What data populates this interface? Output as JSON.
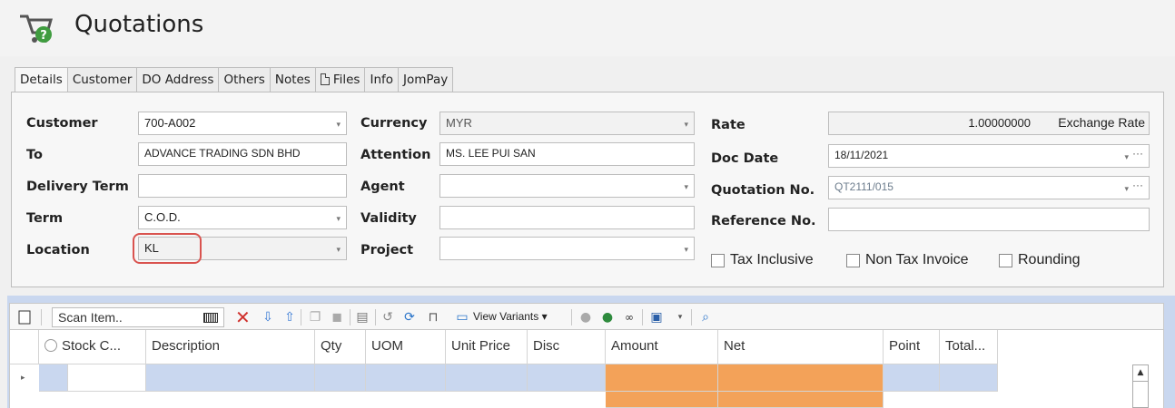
{
  "window": {
    "title": "Quotations"
  },
  "tabs": [
    {
      "label": "Details",
      "active": true
    },
    {
      "label": "Customer"
    },
    {
      "label": "DO Address"
    },
    {
      "label": "Others"
    },
    {
      "label": "Notes"
    },
    {
      "label": "Files",
      "icon": "file-icon"
    },
    {
      "label": "Info"
    },
    {
      "label": "JomPay"
    }
  ],
  "form": {
    "customer_label": "Customer",
    "customer_value": "700-A002",
    "to_label": "To",
    "to_value": "ADVANCE TRADING SDN BHD",
    "delivery_term_label": "Delivery Term",
    "delivery_term_value": "",
    "term_label": "Term",
    "term_value": "C.O.D.",
    "location_label": "Location",
    "location_value": "KL",
    "currency_label": "Currency",
    "currency_value": "MYR",
    "attention_label": "Attention",
    "attention_value": "MS. LEE PUI SAN",
    "agent_label": "Agent",
    "agent_value": "",
    "validity_label": "Validity",
    "validity_value": "",
    "project_label": "Project",
    "project_value": "",
    "rate_label": "Rate",
    "rate_value": "1.00000000",
    "exchange_rate_label": "Exchange Rate",
    "doc_date_label": "Doc Date",
    "doc_date_value": "18/11/2021",
    "quotation_no_label": "Quotation No.",
    "quotation_no_value": "QT2111/015",
    "reference_no_label": "Reference No.",
    "reference_no_value": "",
    "tax_inclusive_label": "Tax Inclusive",
    "non_tax_invoice_label": "Non Tax Invoice",
    "rounding_label": "Rounding"
  },
  "toolbar": {
    "scan_placeholder": "Scan Item..",
    "view_variants_label": "View Variants"
  },
  "grid": {
    "columns": [
      "Stock C...",
      "Description",
      "Qty",
      "UOM",
      "Unit Price",
      "Disc",
      "Amount",
      "Net",
      "Point",
      "Total..."
    ]
  },
  "colors": {
    "highlight": "#d9534f",
    "selected_row": "#c9d7ef",
    "amount_cell": "#f3a259",
    "delete_icon": "#d0312d",
    "up_down_icon": "#3a7bd5"
  }
}
